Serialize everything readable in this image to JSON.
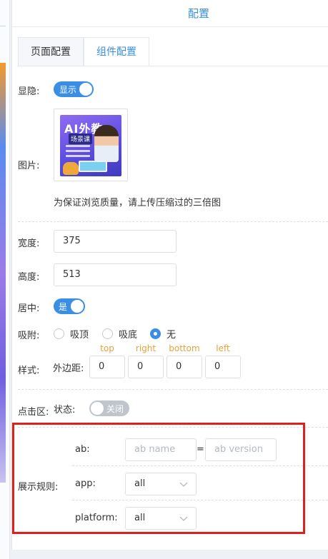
{
  "panel": {
    "title": "配置"
  },
  "tabs": [
    {
      "label": "页面配置"
    },
    {
      "label": "组件配置"
    }
  ],
  "visibility": {
    "label": "显隐:",
    "switch_text": "显示"
  },
  "image": {
    "label": "图片:",
    "thumb_title": "AI外教",
    "thumb_sub": "场景课",
    "hint": "为保证浏览质量，请上传压缩过的三倍图"
  },
  "width": {
    "label": "宽度:",
    "value": "375"
  },
  "height": {
    "label": "高度:",
    "value": "513"
  },
  "center": {
    "label": "居中:",
    "switch_text": "是"
  },
  "sticky": {
    "label": "吸附:",
    "options": [
      "吸顶",
      "吸底",
      "无"
    ],
    "selected": "无"
  },
  "style": {
    "label": "样式:",
    "margin_label": "外边距:",
    "captions": [
      "top",
      "right",
      "bottom",
      "left"
    ],
    "values": [
      "0",
      "0",
      "0",
      "0"
    ]
  },
  "hotarea": {
    "label": "点击区:",
    "state_label": "状态:",
    "switch_text": "关闭"
  },
  "rules": {
    "label": "展示规则:",
    "ab_label": "ab:",
    "ab_name_placeholder": "ab name",
    "equals": "=",
    "ab_version_placeholder": "ab version",
    "app_label": "app:",
    "app_value": "all",
    "platform_label": "platform:",
    "platform_value": "all"
  },
  "colors": {
    "accent": "#3a8ee6",
    "caption": "#e6a23c",
    "highlight": "#e0201c"
  }
}
